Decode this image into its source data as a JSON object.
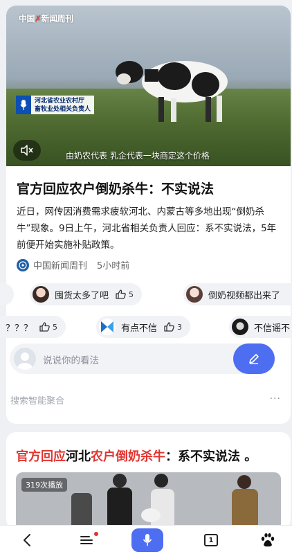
{
  "video": {
    "logo_prefix": "中国",
    "logo_suffix": "新闻周刊",
    "lower_third": [
      "河北省农业农村厅",
      "畜牧业处相关负责人"
    ],
    "subtitle": "由奶农代表 乳企代表一块商定这个价格",
    "mute_icon": "speaker-muted-icon"
  },
  "article": {
    "title": "官方回应农户倒奶杀牛：不实说法",
    "description": "近日，网传因消费需求疲软河北、内蒙古等多地出现“倒奶杀牛”现象。9日上午，河北省相关负责人回应：系不实说法，5年前便开始实施补贴政策。",
    "source": "中国新闻周刊",
    "time": "5小时前"
  },
  "chips": {
    "row1": [
      {
        "text": "囤货太多了吧",
        "likes": "5"
      },
      {
        "text": "倒奶视频都出来了",
        "likes": ""
      }
    ],
    "row2": [
      {
        "text": "？？？",
        "likes": "5"
      },
      {
        "text": "有点不信",
        "likes": "3"
      },
      {
        "text": "不信谣不",
        "likes": ""
      }
    ]
  },
  "comment": {
    "placeholder": "说说你的看法"
  },
  "aggregation": {
    "label": "搜索智能聚合",
    "more": "···"
  },
  "related": {
    "title_red1": "官方回应",
    "title_black1": "河北",
    "title_red2": "农户倒奶杀牛",
    "title_black2": "：系不实说法 。",
    "plays": "319次播放"
  },
  "nav": {
    "tab_count": "1",
    "icons": [
      "back-icon",
      "menu-icon",
      "microphone-icon",
      "tabs-icon",
      "baidu-paw-icon"
    ]
  },
  "colors": {
    "accent": "#4e6ef2",
    "highlight_red": "#e2332f"
  }
}
